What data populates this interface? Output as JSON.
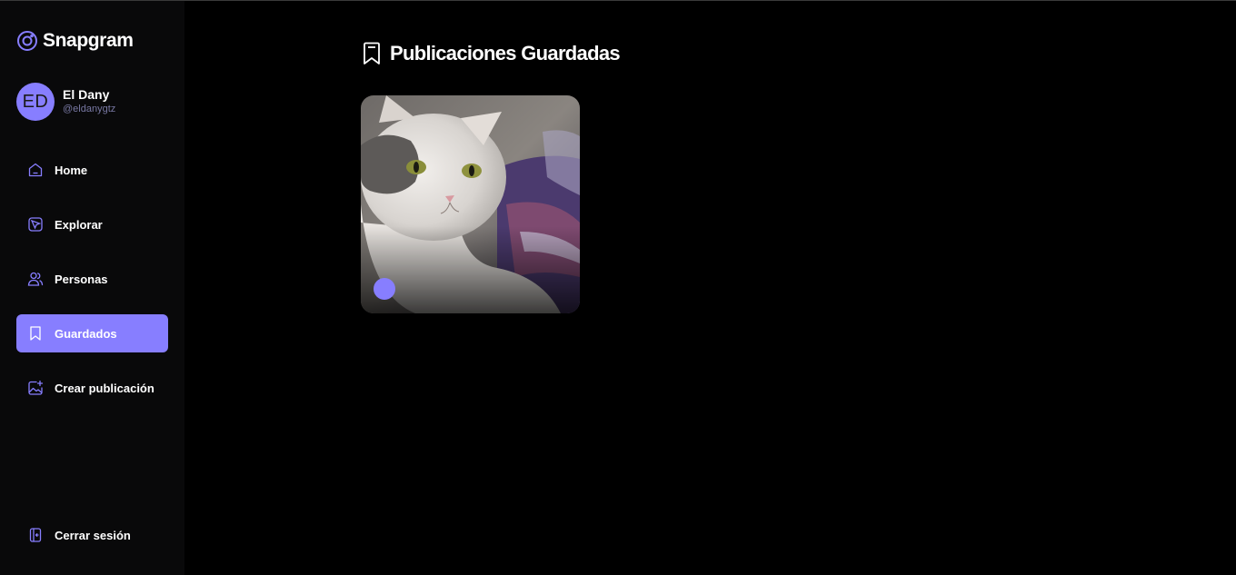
{
  "app": {
    "name": "Snapgram"
  },
  "user": {
    "initials": "ED",
    "name": "El Dany",
    "handle": "@eldanygtz"
  },
  "nav": [
    {
      "label": "Home",
      "icon": "home-icon"
    },
    {
      "label": "Explorar",
      "icon": "explore-icon"
    },
    {
      "label": "Personas",
      "icon": "people-icon"
    },
    {
      "label": "Guardados",
      "icon": "bookmark-icon",
      "active": true
    },
    {
      "label": "Crear publicación",
      "icon": "create-post-icon"
    }
  ],
  "logout": {
    "label": "Cerrar sesión",
    "icon": "logout-icon"
  },
  "page": {
    "title": "Publicaciones Guardadas",
    "icon": "bookmark-icon"
  },
  "saved_posts": [
    {
      "image": "cat-photo"
    }
  ],
  "colors": {
    "accent": "#877eff",
    "sidebar_bg": "#09090a",
    "main_bg": "#000000",
    "muted": "#7878a3"
  }
}
